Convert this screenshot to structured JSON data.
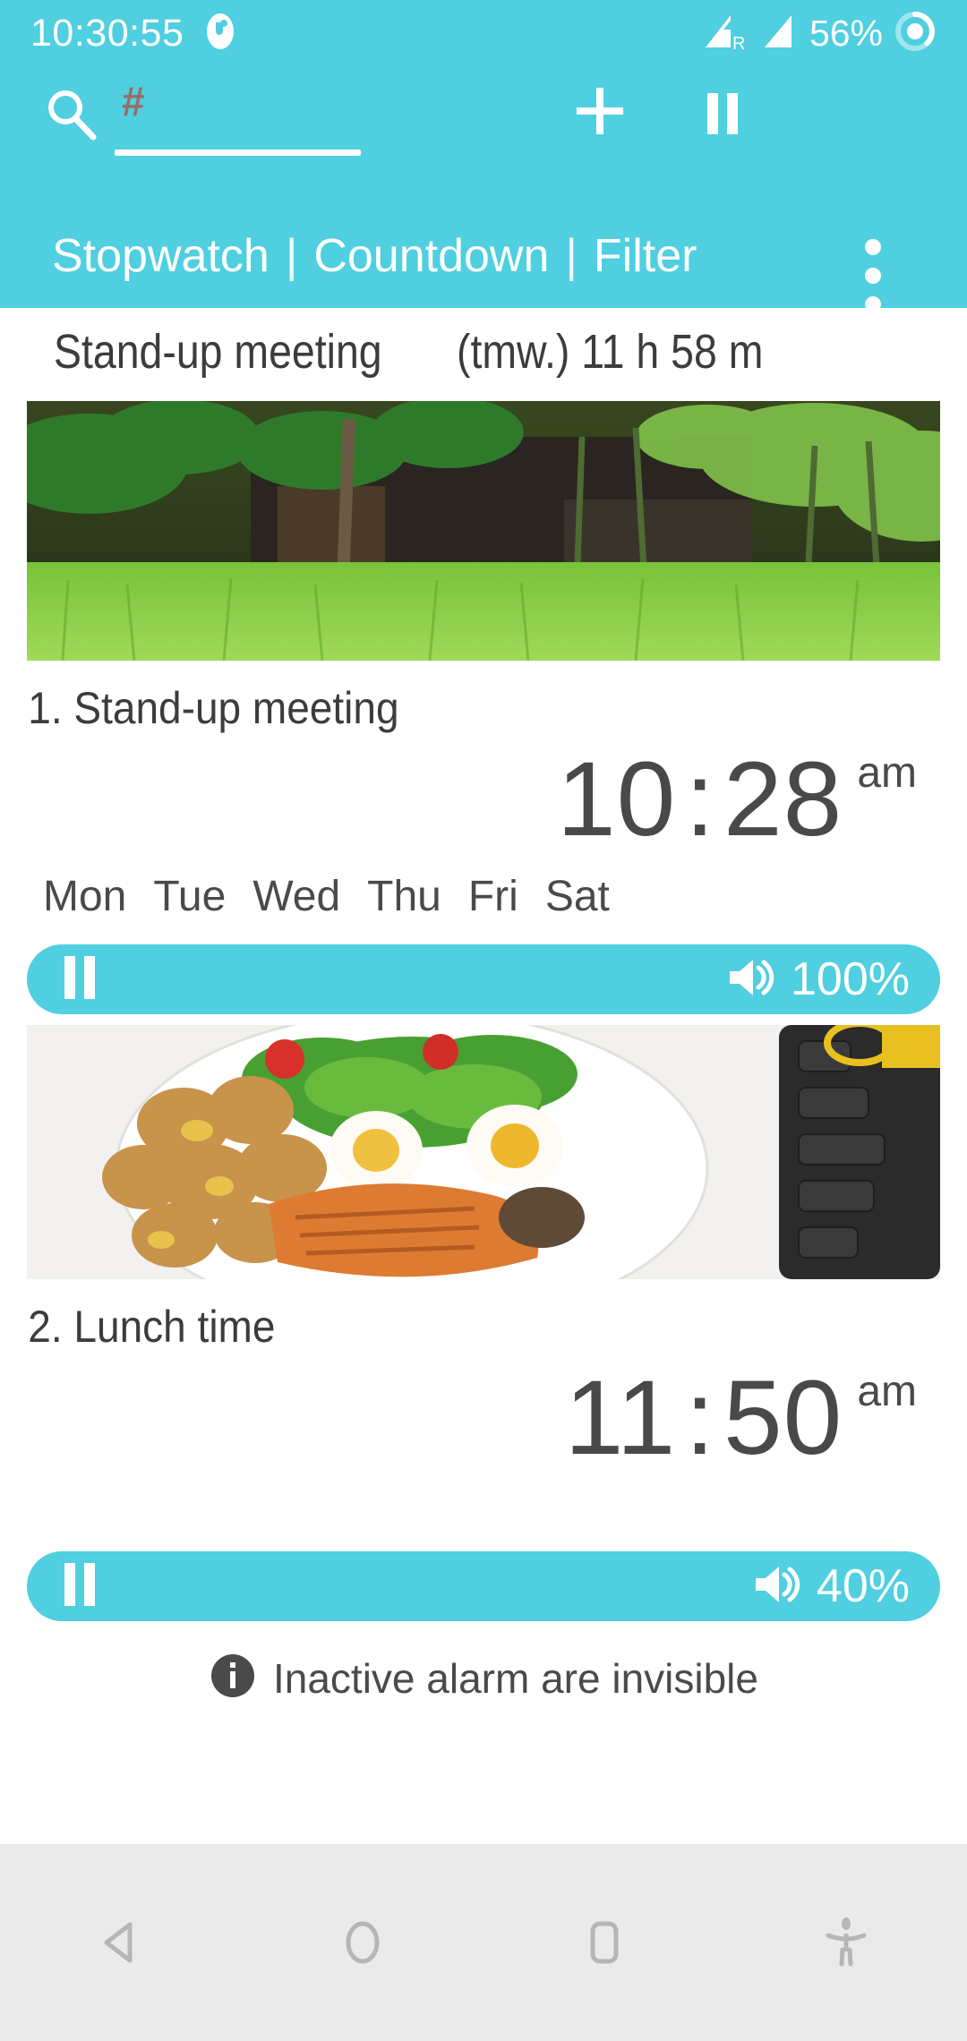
{
  "statusbar": {
    "clock": "10:30:55",
    "battery_pct": "56%",
    "signal1_label": "R",
    "icons": [
      "app-notification-icon",
      "signal-roaming-icon",
      "signal-icon",
      "battery-circle-icon"
    ]
  },
  "appbar": {
    "search_placeholder": "#",
    "search_value": "",
    "add_label": "+",
    "pause_label": "II",
    "overflow_label": "⋮",
    "accent_color": "#4FCFE0"
  },
  "tabs": [
    {
      "label": "Stopwatch"
    },
    {
      "label": "Countdown"
    },
    {
      "label": "Filter"
    }
  ],
  "tab_separator": "|",
  "next_alarm": {
    "title": "Stand-up meeting",
    "remaining": "(tmw.) 11 h 58 m"
  },
  "alarms": [
    {
      "name": "1. Stand-up meeting",
      "hour": "10",
      "colon": ":",
      "minute": "28",
      "ampm": "am",
      "days": [
        "Mon",
        "Tue",
        "Wed",
        "Thu",
        "Fri",
        "Sat"
      ],
      "volume": "100%",
      "pause_label": "II",
      "image": "rice-paddy-hut-photo"
    },
    {
      "name": "2. Lunch time",
      "hour": "11",
      "colon": ":",
      "minute": "50",
      "ampm": "am",
      "days": [],
      "volume": "40%",
      "pause_label": "II",
      "image": "salmon-potato-salad-plate-photo"
    }
  ],
  "footer": {
    "info_icon": "i",
    "text": "Inactive alarm are invisible"
  },
  "navbar": {
    "back": "back-icon",
    "home": "home-icon",
    "recents": "recents-icon",
    "accessibility": "accessibility-icon"
  }
}
